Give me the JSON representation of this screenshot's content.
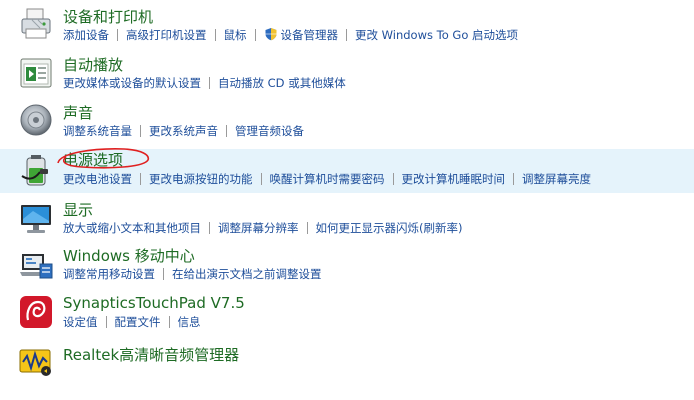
{
  "categories": [
    {
      "title": "设备和打印机",
      "icon": "printer-icon",
      "links": [
        "添加设备",
        "高级打印机设置",
        "鼠标",
        "设备管理器",
        "更改 Windows To Go 启动选项"
      ]
    },
    {
      "title": "自动播放",
      "icon": "autoplay-icon",
      "links": [
        "更改媒体或设备的默认设置",
        "自动播放 CD 或其他媒体"
      ]
    },
    {
      "title": "声音",
      "icon": "speaker-icon",
      "links": [
        "调整系统音量",
        "更改系统声音",
        "管理音频设备"
      ]
    },
    {
      "title": "电源选项",
      "icon": "battery-icon",
      "highlighted": true,
      "links": [
        "更改电池设置",
        "更改电源按钮的功能",
        "唤醒计算机时需要密码",
        "更改计算机睡眠时间",
        "调整屏幕亮度"
      ]
    },
    {
      "title": "显示",
      "icon": "monitor-icon",
      "links": [
        "放大或缩小文本和其他项目",
        "调整屏幕分辨率",
        "如何更正显示器闪烁(刷新率)"
      ]
    },
    {
      "title": "Windows 移动中心",
      "icon": "mobility-center-icon",
      "links": [
        "调整常用移动设置",
        "在给出演示文档之前调整设置"
      ]
    },
    {
      "title": "SynapticsTouchPad V7.5",
      "icon": "synaptics-icon",
      "links": [
        "设定值",
        "配置文件",
        "信息"
      ]
    },
    {
      "title": "Realtek高清晰音频管理器",
      "icon": "realtek-audio-icon",
      "links": []
    }
  ],
  "colors": {
    "title": "#1e6b24",
    "link": "#1e4e9a",
    "highlight": "#e5f3fb",
    "annotation": "#e02020"
  }
}
